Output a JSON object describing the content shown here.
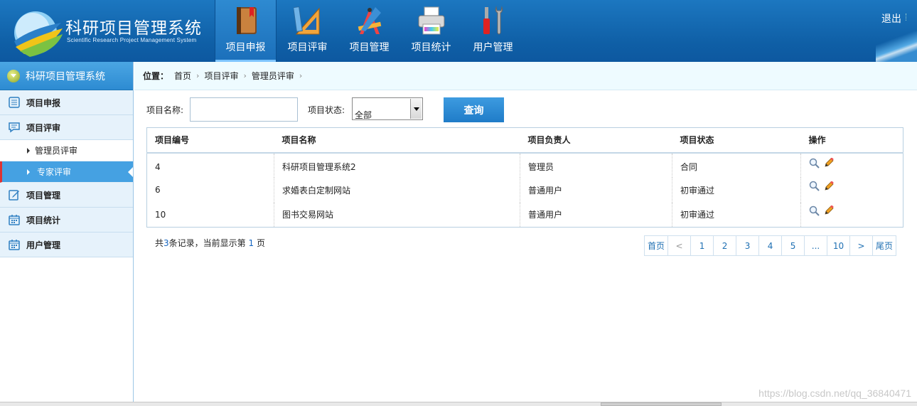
{
  "app": {
    "title": "科研项目管理系统",
    "subtitle": "Scientific Research Project Management System",
    "logout": "退出"
  },
  "nav": [
    {
      "label": "项目申报",
      "icon": "book-icon",
      "active": true
    },
    {
      "label": "项目评审",
      "icon": "ruler-triangle-icon",
      "active": false
    },
    {
      "label": "项目管理",
      "icon": "drafting-tools-icon",
      "active": false
    },
    {
      "label": "项目统计",
      "icon": "printer-icon",
      "active": false
    },
    {
      "label": "用户管理",
      "icon": "tools-icon",
      "active": false
    }
  ],
  "sidebar": {
    "header": "科研项目管理系统",
    "items": [
      {
        "label": "项目申报",
        "icon": "list-icon"
      },
      {
        "label": "项目评审",
        "icon": "comment-icon"
      },
      {
        "label": "管理员评审",
        "sub": true
      },
      {
        "label": "专家评审",
        "sub": true,
        "active": true
      },
      {
        "label": "项目管理",
        "icon": "edit-icon"
      },
      {
        "label": "项目统计",
        "icon": "calendar-icon"
      },
      {
        "label": "用户管理",
        "icon": "calendar-icon"
      }
    ]
  },
  "breadcrumb": {
    "prefix": "位置：",
    "items": [
      "首页",
      "项目评审",
      "管理员评审"
    ]
  },
  "search": {
    "name_label": "项目名称:",
    "name_value": "",
    "status_label": "项目状态:",
    "status_value": "全部",
    "query_button": "查询"
  },
  "table": {
    "headers": [
      "项目编号",
      "项目名称",
      "项目负责人",
      "项目状态",
      "操作"
    ],
    "rows": [
      [
        "4",
        "科研项目管理系统2",
        "管理员",
        "合同"
      ],
      [
        "6",
        "求婚表白定制网站",
        "普通用户",
        "初审通过"
      ],
      [
        "10",
        "图书交易网站",
        "普通用户",
        "初审通过"
      ]
    ]
  },
  "summary": {
    "part1": "共",
    "total": "3",
    "part2": "条记录，当前显示第 ",
    "page": "1",
    "part3": " 页"
  },
  "pager": [
    "首页",
    "<",
    "1",
    "2",
    "3",
    "4",
    "5",
    "...",
    "10",
    ">",
    "尾页"
  ],
  "watermark": "https://blog.csdn.net/qq_36840471"
}
